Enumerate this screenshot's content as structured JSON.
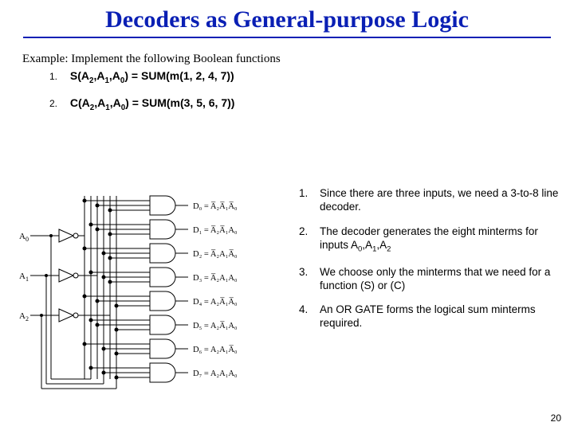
{
  "title": "Decoders as General-purpose Logic",
  "example_line": "Example: Implement the following Boolean functions",
  "equations": {
    "n1": "1.",
    "e1_a": "S(A",
    "e1_b": ",A",
    "e1_c": ",A",
    "e1_d": ") = SUM(m(1, 2, 4, 7))",
    "n2": "2.",
    "e2_a": "C(A",
    "e2_b": ",A",
    "e2_c": ",A",
    "e2_d": ") = SUM(m(3, 5, 6, 7))"
  },
  "diagram_labels": {
    "a0": "A",
    "a0s": "0",
    "a1": "A",
    "a1s": "1",
    "a2": "A",
    "a2s": "2",
    "d0": "D₀ = A̅₂A̅₁A̅₀",
    "d1": "D₁ = A̅₂A̅₁A₀",
    "d2": "D₂ = A̅₂A₁A̅₀",
    "d3": "D₃ = A̅₂A₁A₀",
    "d4": "D₄ = A₂A̅₁A̅₀",
    "d5": "D₅ = A₂A̅₁A₀",
    "d6": "D₆ = A₂A₁A̅₀",
    "d7": "D₇ = A₂A₁A₀"
  },
  "steps": {
    "s1n": "1.",
    "s1a": "Since there are three inputs, we need a 3-to-8 line decoder.",
    "s2n": "2.",
    "s2a": "The decoder generates the eight minterms for inputs A",
    "s2b": ",A",
    "s2c": ",A",
    "s3n": "3.",
    "s3a": "We choose only the minterms that we need for a function (S) or (C)",
    "s4n": "4.",
    "s4a": "An OR GATE forms the logical sum minterms required."
  },
  "pagenum": "20"
}
